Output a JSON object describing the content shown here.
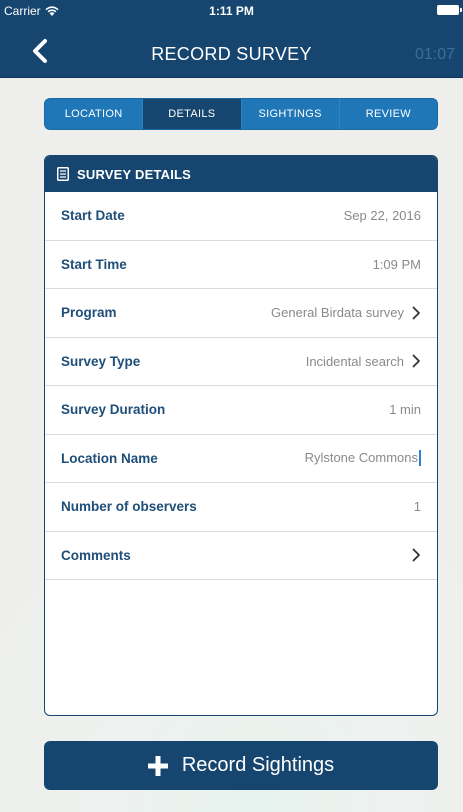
{
  "status_bar": {
    "carrier": "Carrier",
    "time": "1:11 PM",
    "icons": [
      "wifi-icon",
      "battery-icon"
    ]
  },
  "nav": {
    "title": "RECORD SURVEY",
    "timer": "01:07",
    "back_icon": "chevron-left-icon"
  },
  "tabs": [
    {
      "label": "LOCATION",
      "active": false
    },
    {
      "label": "DETAILS",
      "active": true
    },
    {
      "label": "SIGHTINGS",
      "active": false
    },
    {
      "label": "REVIEW",
      "active": false
    }
  ],
  "card": {
    "title": "SURVEY DETAILS",
    "icon": "document-icon",
    "rows": [
      {
        "label": "Start Date",
        "value": "Sep 22, 2016",
        "chevron": false
      },
      {
        "label": "Start Time",
        "value": "1:09 PM",
        "chevron": false
      },
      {
        "label": "Program",
        "value": "General Birdata survey",
        "chevron": true
      },
      {
        "label": "Survey Type",
        "value": "Incidental search",
        "chevron": true
      },
      {
        "label": "Survey Duration",
        "value": "1 min",
        "chevron": false
      },
      {
        "label": "Location Name",
        "value": "Rylstone Commons",
        "chevron": false
      },
      {
        "label": "Number of observers",
        "value": "1",
        "chevron": false
      },
      {
        "label": "Comments",
        "value": "",
        "chevron": true
      }
    ]
  },
  "record_button": {
    "label": "Record Sightings",
    "icon": "plus-icon"
  },
  "colors": {
    "primary": "#16466f",
    "tab_bar": "#1f77b7",
    "label": "#1f4e78",
    "value": "#8a8a8a",
    "cursor": "#2e7fd8"
  }
}
